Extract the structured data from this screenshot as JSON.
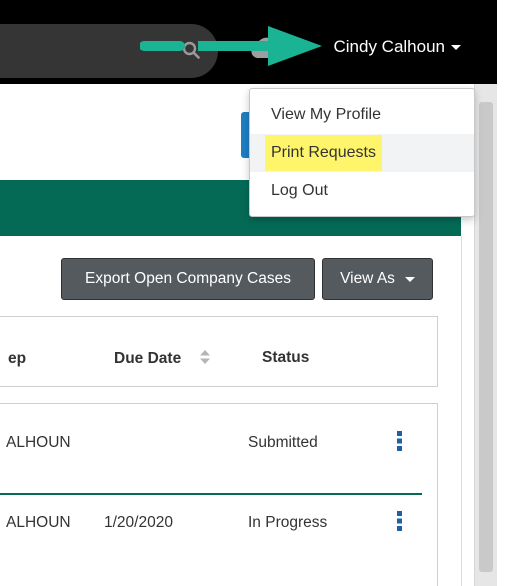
{
  "header": {
    "user_name": "Cindy Calhoun",
    "icons": [
      "search-icon",
      "cloud-icon",
      "chevron-down-icon"
    ]
  },
  "user_menu": {
    "items": [
      {
        "label": "View My Profile"
      },
      {
        "label": "Print Requests",
        "highlighted": true
      },
      {
        "label": "Log Out"
      }
    ]
  },
  "toolbar": {
    "export_label": "Export Open Company Cases",
    "view_as_label": "View As"
  },
  "table": {
    "columns": [
      "ep",
      "Due Date",
      "Status"
    ],
    "rows": [
      {
        "name": "ALHOUN",
        "due_date": "",
        "status": "Submitted"
      },
      {
        "name": "ALHOUN",
        "due_date": "1/20/2020",
        "status": "In Progress"
      }
    ]
  },
  "colors": {
    "topbar": "#000000",
    "brand_green": "#046a56",
    "accent_blue": "#1d7fc4",
    "button_dark": "#555a5e",
    "annotation_arrow": "#1ab394",
    "highlight": "#fff56b"
  }
}
